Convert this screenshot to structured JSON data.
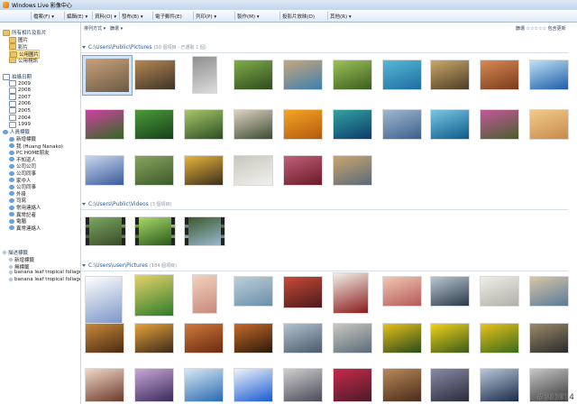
{
  "app": {
    "title": "Windows Live 影像中心"
  },
  "menu": [
    "檔案(F) ▾",
    "編輯(E) ▾",
    "資料(O) ▾",
    "發布(B) ▾",
    "電子郵件(E)",
    "列印(P) ▾",
    "製作(M) ▾",
    "投影片放映(D)",
    "其他(R) ▾"
  ],
  "toolbar": {
    "sort": "排列方式 ▾",
    "filter": "篩選 ▾",
    "rating_label": "篩選 ☆☆☆☆☆ 包含更新"
  },
  "sidebar": {
    "groups": [
      {
        "label": "所有相片及影片",
        "items": [
          "圖片",
          "影片",
          "公用圖片",
          "公用視訊"
        ]
      },
      {
        "label": "拍攝日期",
        "items": [
          "2009",
          "2008",
          "2007",
          "2006",
          "2005",
          "2004",
          "1999"
        ]
      },
      {
        "label": "人員標籤",
        "items": [
          "新增標籤",
          "我 (Huang Nanako)",
          "PC HOME朋友",
          "不知道人",
          "公司公司",
          "公司同事",
          "家中人",
          "公司同事",
          "外掛",
          "司寫",
          "常用連絡人",
          "異常記者",
          "電腦",
          "異常連絡人"
        ]
      },
      {
        "label": "描述標籤",
        "items": [
          "新增標籤",
          "無標籤",
          "banana leaf tropical foliage",
          "banana leaf tropical foliage"
        ]
      }
    ]
  },
  "sections": [
    {
      "path": "C:\\Users\\Public\\Pictures",
      "count": "(30 個項目 - 已選取 1 個)"
    },
    {
      "path": "C:\\Users\\Public\\Videos",
      "count": "(3 個項目)"
    },
    {
      "path": "C:\\Users\\user\\Pictures",
      "count": "(184 個項目)"
    }
  ],
  "watermark": "#363914",
  "colors": {
    "accent": "#1e5ea8",
    "selection": "#cfe2f7"
  }
}
